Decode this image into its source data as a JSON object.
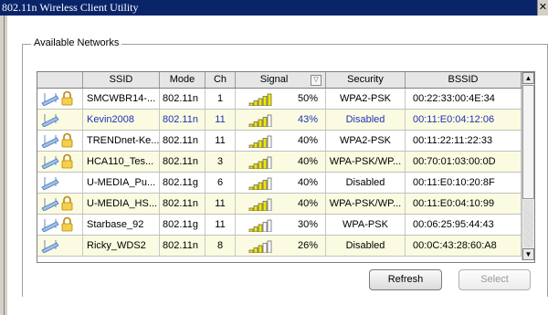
{
  "window": {
    "title": "802.11n Wireless Client Utility",
    "close_glyph": "✕"
  },
  "group": {
    "legend": "Available Networks"
  },
  "table": {
    "headers": {
      "ssid": "SSID",
      "mode": "Mode",
      "ch": "Ch",
      "signal": "Signal",
      "security": "Security",
      "bssid": "BSSID"
    },
    "rows": [
      {
        "ssid": "SMCWBR14-...",
        "mode": "802.11n",
        "ch": "1",
        "signal": "50%",
        "signal_bars": 5,
        "security": "WPA2-PSK",
        "bssid": "00:22:33:00:4E:34",
        "locked": true,
        "highlight": false
      },
      {
        "ssid": "Kevin2008",
        "mode": "802.11n",
        "ch": "11",
        "signal": "43%",
        "signal_bars": 4,
        "security": "Disabled",
        "bssid": "00:11:E0:04:12:06",
        "locked": false,
        "highlight": true
      },
      {
        "ssid": "TRENDnet-Ke...",
        "mode": "802.11n",
        "ch": "11",
        "signal": "40%",
        "signal_bars": 4,
        "security": "WPA2-PSK",
        "bssid": "00:11:22:11:22:33",
        "locked": true,
        "highlight": false
      },
      {
        "ssid": "HCA110_Tes...",
        "mode": "802.11n",
        "ch": "3",
        "signal": "40%",
        "signal_bars": 4,
        "security": "WPA-PSK/WP...",
        "bssid": "00:70:01:03:00:0D",
        "locked": true,
        "highlight": false
      },
      {
        "ssid": "U-MEDIA_Pu...",
        "mode": "802.11g",
        "ch": "6",
        "signal": "40%",
        "signal_bars": 4,
        "security": "Disabled",
        "bssid": "00:11:E0:10:20:8F",
        "locked": false,
        "highlight": false
      },
      {
        "ssid": "U-MEDIA_HS...",
        "mode": "802.11n",
        "ch": "11",
        "signal": "40%",
        "signal_bars": 4,
        "security": "WPA-PSK/WP...",
        "bssid": "00:11:E0:04:10:99",
        "locked": true,
        "highlight": false
      },
      {
        "ssid": "Starbase_92",
        "mode": "802.11g",
        "ch": "11",
        "signal": "30%",
        "signal_bars": 3,
        "security": "WPA-PSK",
        "bssid": "00:06:25:95:44:43",
        "locked": true,
        "highlight": false
      },
      {
        "ssid": "Ricky_WDS2",
        "mode": "802.11n",
        "ch": "8",
        "signal": "26%",
        "signal_bars": 3,
        "security": "Disabled",
        "bssid": "00:0C:43:28:60:A8",
        "locked": false,
        "highlight": false
      }
    ]
  },
  "buttons": {
    "refresh": "Refresh",
    "select": "Select"
  },
  "scrollbar": {
    "up_glyph": "▲",
    "down_glyph": "▼"
  },
  "icons": {
    "network": "wireless-network-icon",
    "lock": "lock-icon",
    "signal": "signal-bars-icon",
    "sort": "sort-filter-icon"
  },
  "colors": {
    "titlebar": "#0a246a",
    "row_alt": "#fbfbe2",
    "highlight_text": "#1f32b8",
    "signal_bar": "#f2e600"
  }
}
